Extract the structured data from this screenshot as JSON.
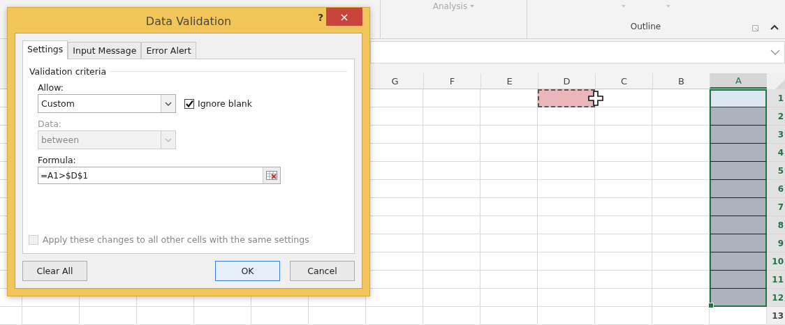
{
  "ribbon": {
    "groups": [
      {
        "label": "Analysis",
        "disabled": true
      },
      {
        "label": "Outline",
        "disabled": false
      }
    ]
  },
  "sheet": {
    "columns": [
      {
        "label": "G",
        "selected": false,
        "copy_marquee": false
      },
      {
        "label": "F",
        "selected": false,
        "copy_marquee": false
      },
      {
        "label": "E",
        "selected": false,
        "copy_marquee": false
      },
      {
        "label": "D",
        "selected": false,
        "copy_marquee": true
      },
      {
        "label": "C",
        "selected": false,
        "copy_marquee": false
      },
      {
        "label": "B",
        "selected": false,
        "copy_marquee": false
      },
      {
        "label": "A",
        "selected": true,
        "copy_marquee": false
      }
    ],
    "rows": [
      {
        "label": "1",
        "selected": true
      },
      {
        "label": "2",
        "selected": true
      },
      {
        "label": "3",
        "selected": true
      },
      {
        "label": "4",
        "selected": true
      },
      {
        "label": "5",
        "selected": true
      },
      {
        "label": "6",
        "selected": true
      },
      {
        "label": "7",
        "selected": true
      },
      {
        "label": "8",
        "selected": true
      },
      {
        "label": "9",
        "selected": true
      },
      {
        "label": "10",
        "selected": true
      },
      {
        "label": "11",
        "selected": true
      },
      {
        "label": "12",
        "selected": true
      },
      {
        "label": "13",
        "selected": false
      }
    ]
  },
  "dialog": {
    "title": "Data Validation",
    "help": "?",
    "close": "×",
    "tabs": [
      {
        "label": "Settings",
        "selected": true
      },
      {
        "label": "Input Message",
        "selected": false
      },
      {
        "label": "Error Alert",
        "selected": false
      }
    ],
    "section": "Validation criteria",
    "allow": {
      "label": "Allow:",
      "value": "Custom",
      "disabled": false
    },
    "ignore_blank": {
      "label": "Ignore blank",
      "checked": true
    },
    "data": {
      "label": "Data:",
      "value": "between",
      "disabled": true
    },
    "formula": {
      "label": "Formula:",
      "value": "=A1>$D$1"
    },
    "apply_all": {
      "label": "Apply these changes to all other cells with the same settings",
      "checked": false,
      "disabled": true
    },
    "buttons": [
      {
        "label": "Clear All",
        "default": false
      },
      {
        "label": "OK",
        "default": true
      },
      {
        "label": "Cancel",
        "default": false
      }
    ]
  }
}
